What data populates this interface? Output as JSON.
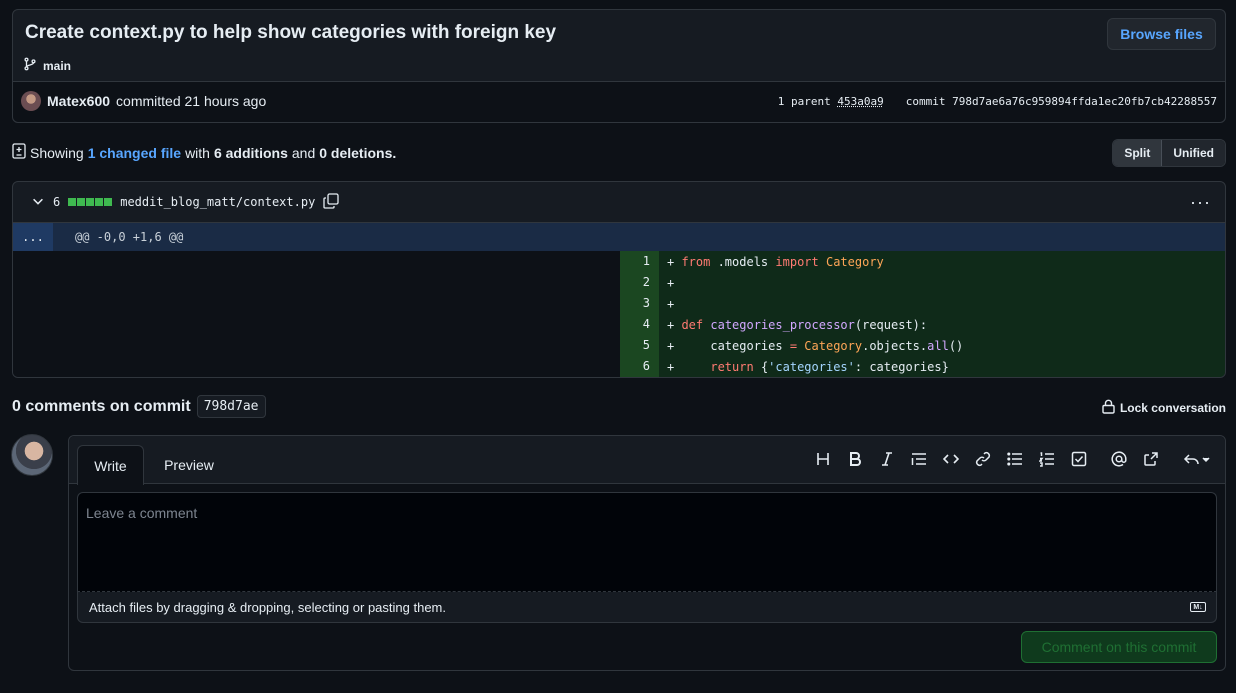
{
  "commit": {
    "title": "Create context.py to help show categories with foreign key",
    "branch": "main",
    "browse_label": "Browse files",
    "author": "Matex600",
    "action": "committed 21 hours ago",
    "parent_label": "1 parent",
    "parent_sha": "453a0a9",
    "commit_label": "commit",
    "commit_sha": "798d7ae6a76c959894ffda1ec20fb7cb42288557"
  },
  "summary": {
    "showing": "Showing",
    "changed": "1 changed file",
    "with": "with",
    "additions": "6 additions",
    "and": "and",
    "deletions": "0 deletions.",
    "split_label": "Split",
    "unified_label": "Unified"
  },
  "file": {
    "count": "6",
    "path": "meddit_blog_matt/context.py",
    "hunk_expander": "...",
    "hunk": "@@ -0,0 +1,6 @@",
    "lines": [
      {
        "num": "1",
        "code": "+ from .models import Category"
      },
      {
        "num": "2",
        "code": "+"
      },
      {
        "num": "3",
        "code": "+"
      },
      {
        "num": "4",
        "code": "+ def categories_processor(request):"
      },
      {
        "num": "5",
        "code": "+     categories = Category.objects.all()"
      },
      {
        "num": "6",
        "code": "+     return {'categories': categories}"
      }
    ]
  },
  "comments": {
    "heading": "0 comments on commit",
    "sha": "798d7ae",
    "lock_label": "Lock conversation",
    "write_tab": "Write",
    "preview_tab": "Preview",
    "placeholder": "Leave a comment",
    "attach_text": "Attach files by dragging & dropping, selecting or pasting them.",
    "submit_label": "Comment on this commit"
  },
  "colors": {
    "accent": "#58a6ff",
    "addition": "#3fb950",
    "background": "#0d1117"
  }
}
